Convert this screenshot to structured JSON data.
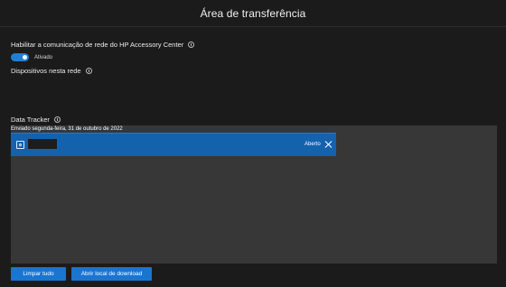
{
  "window": {
    "title": "Área de transferência"
  },
  "network": {
    "enable_label": "Habilitar a comunicação de rede do HP Accessory Center",
    "toggle_state": "Ativado",
    "devices_label": "Dispositivos nesta rede"
  },
  "tracker": {
    "label": "Data Tracker",
    "sent_date": "Enviado segunda-feira, 31 de outubro de 2022",
    "item": {
      "name": "",
      "status": "Aberto",
      "icon": "image-file-icon"
    }
  },
  "actions": {
    "clear_all": "Limpar tudo",
    "open_download": "Abrir local de download"
  },
  "colors": {
    "background": "#1b1b1b",
    "panel": "#373737",
    "accent": "#1a75d1",
    "item_bar": "#1462ad"
  }
}
